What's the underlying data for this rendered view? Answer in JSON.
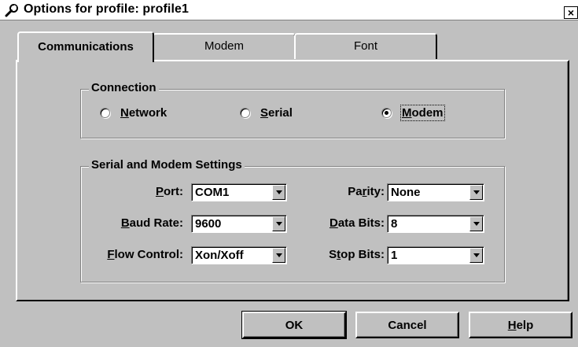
{
  "window": {
    "title": "Options for profile: profile1",
    "icon": "wrench-icon",
    "close_glyph": "×"
  },
  "tabs": [
    {
      "label": "Communications",
      "active": true
    },
    {
      "label": "Modem",
      "active": false
    },
    {
      "label": "Font",
      "active": false
    }
  ],
  "connection": {
    "group_label": "Connection",
    "options": [
      {
        "pre": "",
        "ul": "N",
        "post": "etwork",
        "selected": false
      },
      {
        "pre": "",
        "ul": "S",
        "post": "erial",
        "selected": false
      },
      {
        "pre": "",
        "ul": "M",
        "post": "odem",
        "selected": true
      }
    ]
  },
  "settings": {
    "group_label": "Serial and Modem Settings",
    "port": {
      "pre": "",
      "ul": "P",
      "post": "ort:",
      "value": "COM1"
    },
    "baud_rate": {
      "pre": "",
      "ul": "B",
      "post": "aud Rate:",
      "value": "9600"
    },
    "flow_control": {
      "pre": "",
      "ul": "F",
      "post": "low Control:",
      "value": "Xon/Xoff"
    },
    "parity": {
      "pre": "Pa",
      "ul": "r",
      "post": "ity:",
      "value": "None"
    },
    "data_bits": {
      "pre": "",
      "ul": "D",
      "post": "ata Bits:",
      "value": "8"
    },
    "stop_bits": {
      "pre": "S",
      "ul": "t",
      "post": "op Bits:",
      "value": "1"
    }
  },
  "buttons": {
    "ok": "OK",
    "cancel": "Cancel",
    "help": {
      "pre": "",
      "ul": "H",
      "post": "elp"
    }
  }
}
